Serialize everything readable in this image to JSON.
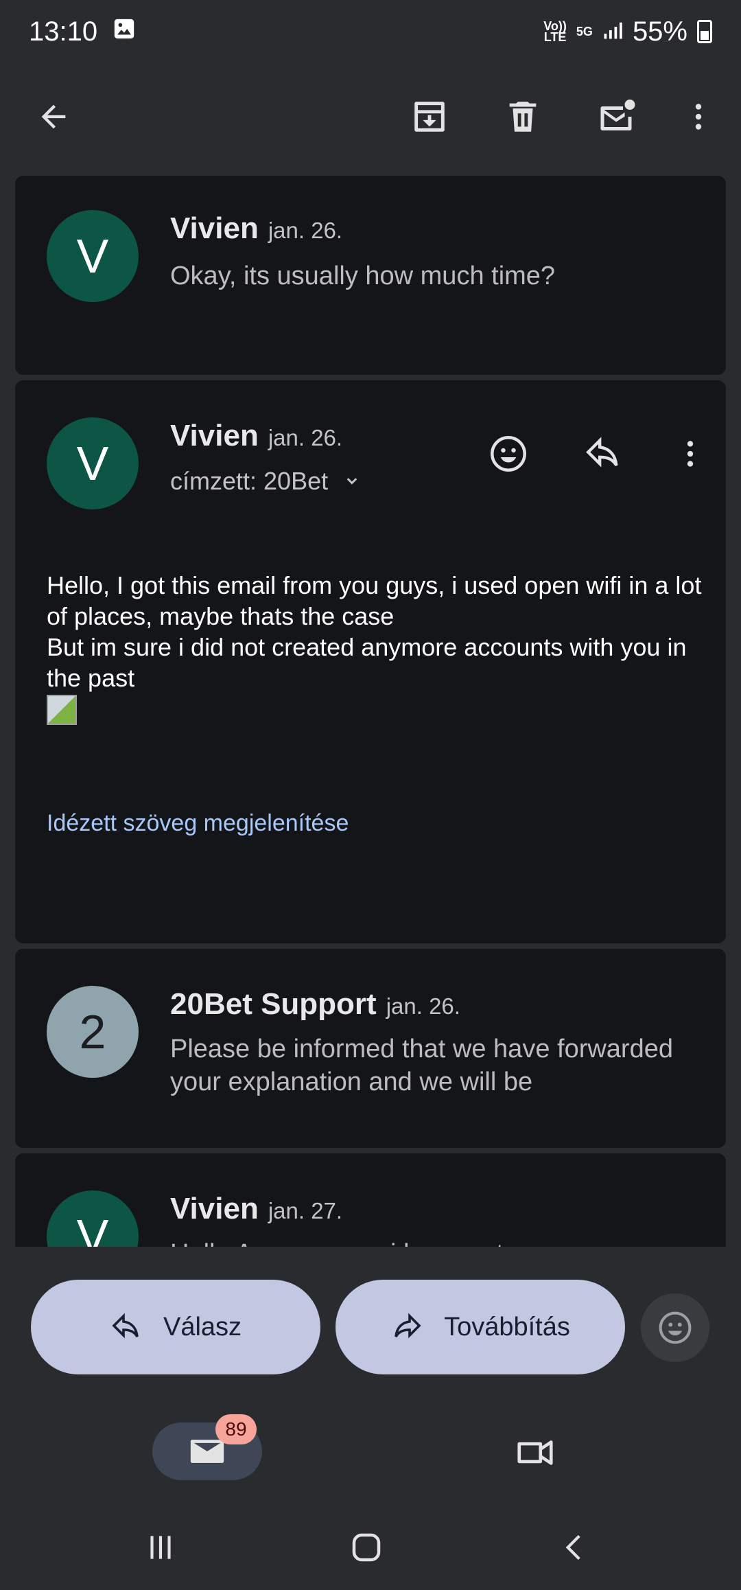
{
  "status_bar": {
    "time": "13:10",
    "volte": "Vo)) LTE",
    "network": "5G",
    "battery": "55%"
  },
  "toolbar": {
    "back_icon": "arrow-left-icon",
    "archive_icon": "archive-icon",
    "delete_icon": "trash-icon",
    "mark_unread_icon": "mail-unread-icon",
    "more_icon": "more-vert-icon"
  },
  "thread": [
    {
      "avatar_letter": "V",
      "sender": "Vivien",
      "date": "jan. 26.",
      "snippet": "Okay, its usually how much time?"
    },
    {
      "avatar_letter": "V",
      "sender": "Vivien",
      "date": "jan. 26.",
      "recipient": "címzett: 20Bet",
      "body": "Hello, I got this email from you guys, i used open wifi in a lot of places, maybe thats the case\nBut im sure i did not created anymore accounts with you in the past",
      "show_quoted": "Idézett szöveg megjelenítése"
    },
    {
      "avatar_letter": "2",
      "sender": "20Bet Support",
      "date": "jan. 26.",
      "snippet": "Please be informed that we have forwarded your explanation and we will be"
    },
    {
      "avatar_letter": "V",
      "sender": "Vivien",
      "date": "jan. 27.",
      "snippet": "Hello Are you sure i have not"
    }
  ],
  "actions": {
    "reply_label": "Válasz",
    "forward_label": "Továbbítás"
  },
  "bottom_nav": {
    "mail_badge": "89"
  },
  "colors": {
    "background": "#2a2b2f",
    "card": "#141518",
    "avatar_green": "#0d5544",
    "pill": "#c2c7e2",
    "link": "#a8c7fa",
    "badge": "#f7a59b"
  }
}
